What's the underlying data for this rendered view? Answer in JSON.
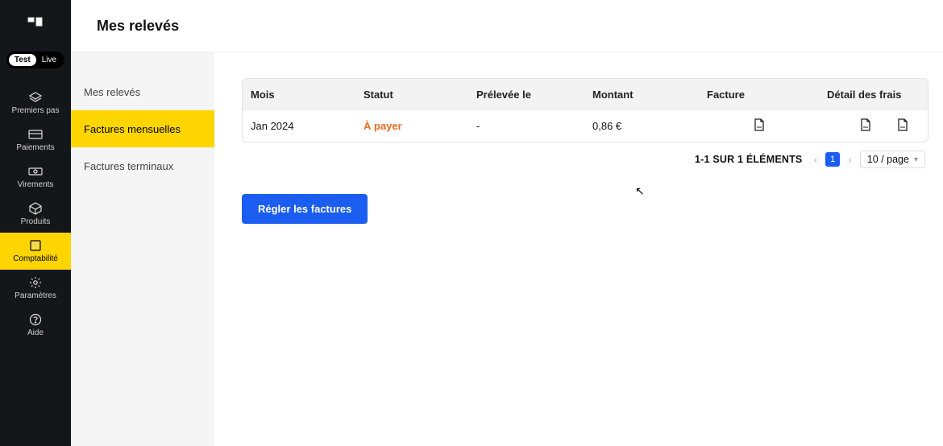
{
  "header": {
    "title": "Mes relevés"
  },
  "mode_toggle": {
    "test": "Test",
    "live": "Live"
  },
  "nav": {
    "items": [
      {
        "id": "onboarding",
        "label": "Premiers pas"
      },
      {
        "id": "payments",
        "label": "Paiements"
      },
      {
        "id": "transfers",
        "label": "Virements"
      },
      {
        "id": "products",
        "label": "Produits"
      },
      {
        "id": "accounting",
        "label": "Comptabilité"
      },
      {
        "id": "settings",
        "label": "Paramètres"
      },
      {
        "id": "help",
        "label": "Aide"
      }
    ]
  },
  "sidebar": {
    "items": [
      {
        "id": "statements",
        "label": "Mes relevés"
      },
      {
        "id": "monthly",
        "label": "Factures mensuelles"
      },
      {
        "id": "terminals",
        "label": "Factures terminaux"
      }
    ]
  },
  "table": {
    "columns": {
      "month": "Mois",
      "status": "Statut",
      "debited": "Prélevée le",
      "amount": "Montant",
      "invoice": "Facture",
      "detail": "Détail des frais"
    },
    "rows": [
      {
        "month": "Jan 2024",
        "status": "À payer",
        "debited": "-",
        "amount": "0,86 €"
      }
    ]
  },
  "pagination": {
    "summary": "1-1 SUR 1 ÉLÉMENTS",
    "current_page": "1",
    "per_page_label": "10 / page"
  },
  "actions": {
    "pay_invoices": "Régler les factures"
  }
}
